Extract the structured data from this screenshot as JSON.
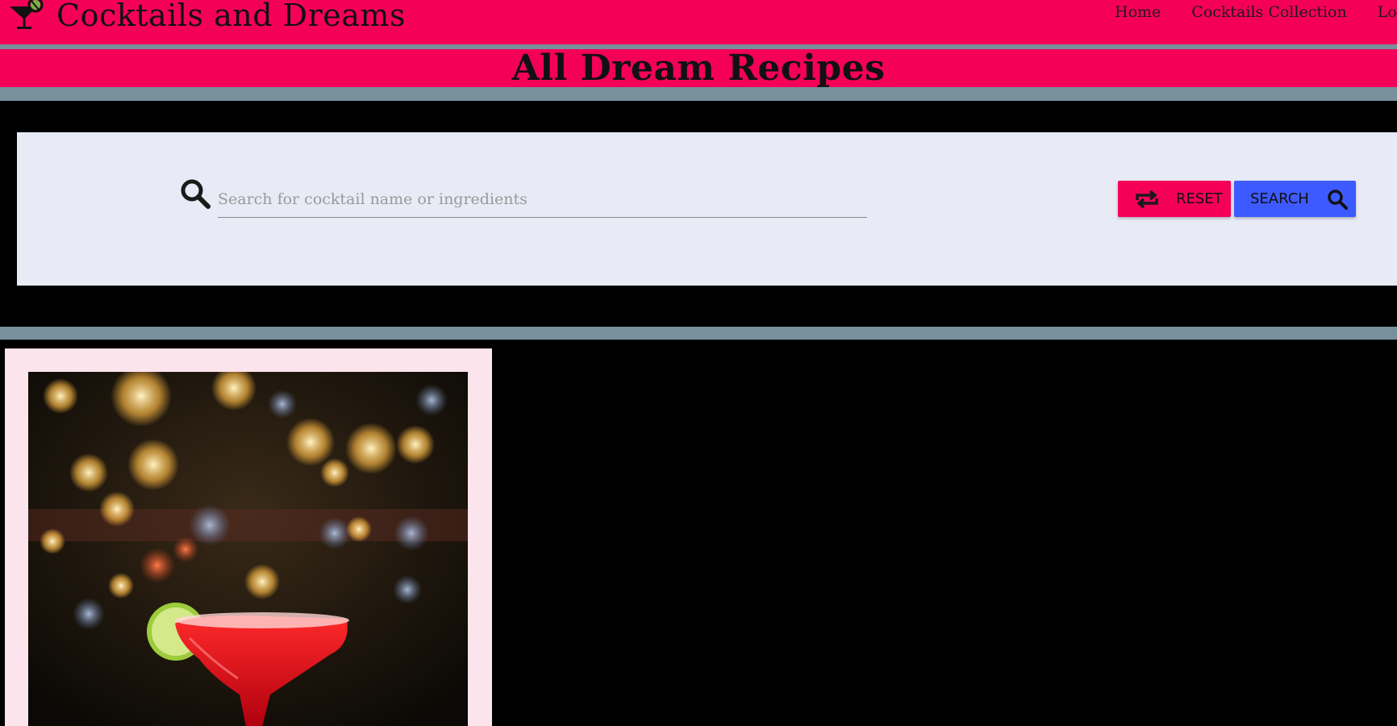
{
  "app": {
    "title": "Cocktails and Dreams",
    "brand_icon": "cocktail-glass-icon"
  },
  "nav": {
    "items": [
      {
        "label": "Home"
      },
      {
        "label": "Cocktails Collection"
      },
      {
        "label": "Log"
      }
    ]
  },
  "page": {
    "title": "All Dream Recipes"
  },
  "search": {
    "placeholder": "Search for cocktail name or ingredients",
    "value": "",
    "icon": "search-icon"
  },
  "buttons": {
    "reset_label": "RESET",
    "reset_icon": "repeat-icon",
    "search_label": "SEARCH",
    "search_icon": "search-icon"
  },
  "colors": {
    "primary": "#f50057",
    "accent": "#3d5afe",
    "band": "#78909c",
    "panel": "#e8eaf6",
    "card": "#fce4ec"
  },
  "cards": [
    {
      "image": "red-margarita-cocktail-photo"
    }
  ]
}
